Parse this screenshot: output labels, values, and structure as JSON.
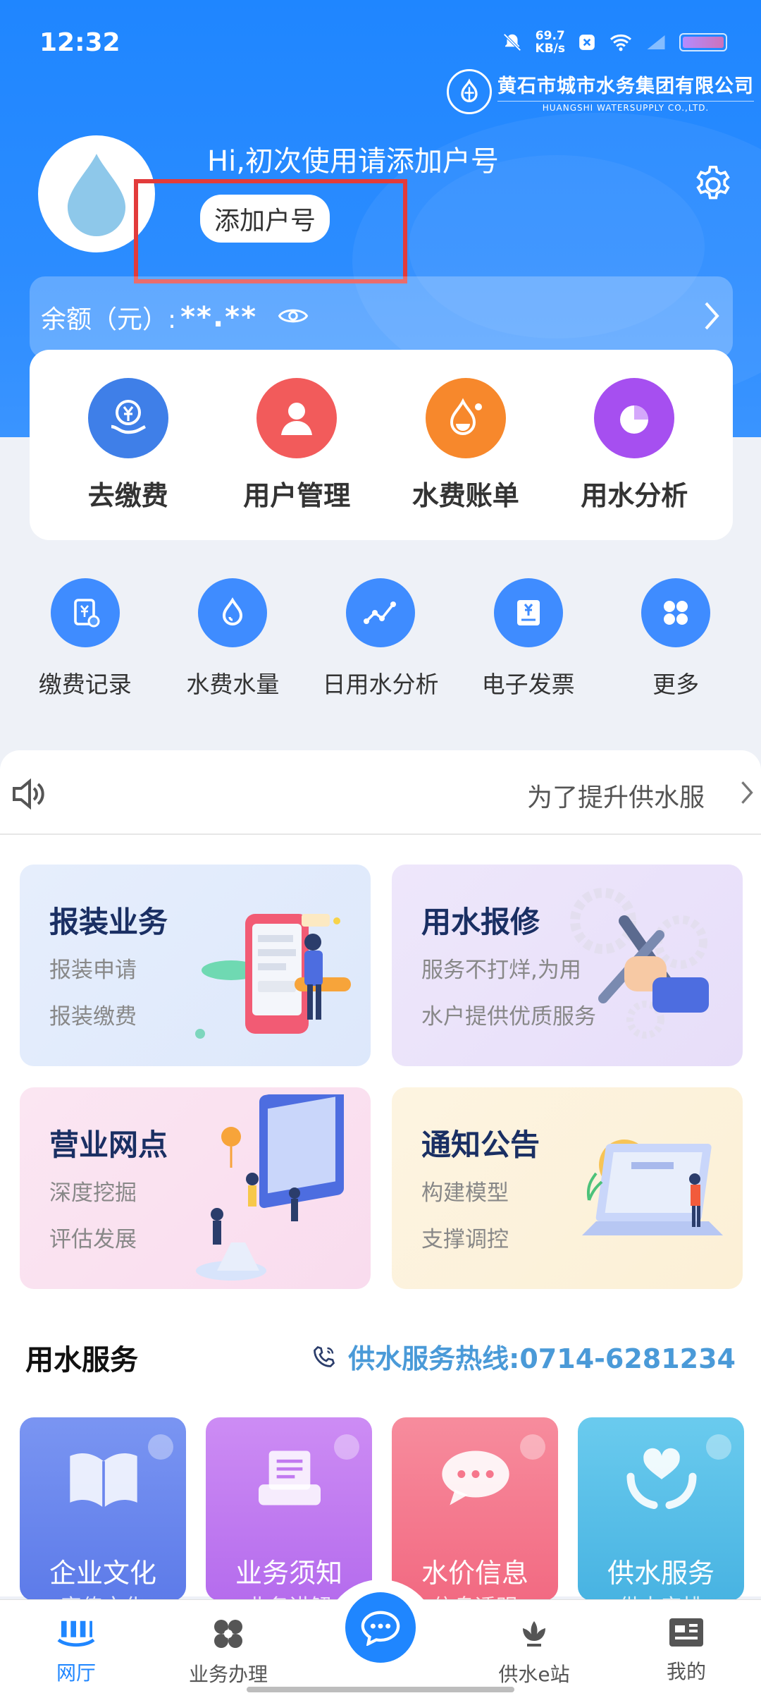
{
  "status": {
    "time": "12:32",
    "speed_value": "69.7",
    "speed_unit": "KB/s"
  },
  "logo": {
    "title": "黄石市城市水务集团有限公司",
    "subtitle": "HUANGSHI WATERSUPPLY CO.,LTD."
  },
  "profile": {
    "greeting": "Hi,初次使用请添加户号",
    "add_button": "添加户号"
  },
  "balance": {
    "label": "余额（元）:",
    "value": "**.**"
  },
  "quick_actions": [
    {
      "label": "去缴费",
      "color": "#3f7fe8",
      "icon": "pay-icon"
    },
    {
      "label": "用户管理",
      "color": "#f25b5b",
      "icon": "user-icon"
    },
    {
      "label": "水费账单",
      "color": "#f7882c",
      "icon": "bill-icon"
    },
    {
      "label": "用水分析",
      "color": "#a64ff0",
      "icon": "pie-icon"
    }
  ],
  "sub_actions": [
    {
      "label": "缴费记录",
      "icon": "record-icon"
    },
    {
      "label": "水费水量",
      "icon": "drop-icon"
    },
    {
      "label": "日用水分析",
      "icon": "line-chart-icon"
    },
    {
      "label": "电子发票",
      "icon": "invoice-icon"
    },
    {
      "label": "更多",
      "icon": "more-icon"
    }
  ],
  "notice": {
    "text": "为了提升供水服"
  },
  "service_cards": [
    {
      "title": "报装业务",
      "line1": "报装申请",
      "line2": "报装缴费"
    },
    {
      "title": "用水报修",
      "line1": "服务不打烊,为用",
      "line2": "水户提供优质服务"
    },
    {
      "title": "营业网点",
      "line1": "深度挖掘",
      "line2": "评估发展"
    },
    {
      "title": "通知公告",
      "line1": "构建模型",
      "line2": "支撑调控"
    }
  ],
  "section": {
    "title": "用水服务",
    "hotline": "供水服务热线:0714-6281234"
  },
  "tiles": [
    {
      "label": "企业文化",
      "sub": "宣传文化",
      "color": "#6b86ee"
    },
    {
      "label": "业务须知",
      "sub": "业务讲解",
      "color": "#c17af0"
    },
    {
      "label": "水价信息",
      "sub": "信息透明",
      "color": "#f6778c"
    },
    {
      "label": "供水服务",
      "sub": "供水安排",
      "color": "#58bfe8"
    }
  ],
  "nav": [
    {
      "label": "网厅"
    },
    {
      "label": "业务办理"
    },
    {
      "label": "供水e站"
    },
    {
      "label": "我的"
    }
  ],
  "colors": {
    "primary": "#1f86ff",
    "highlight": "#e23b3b"
  }
}
